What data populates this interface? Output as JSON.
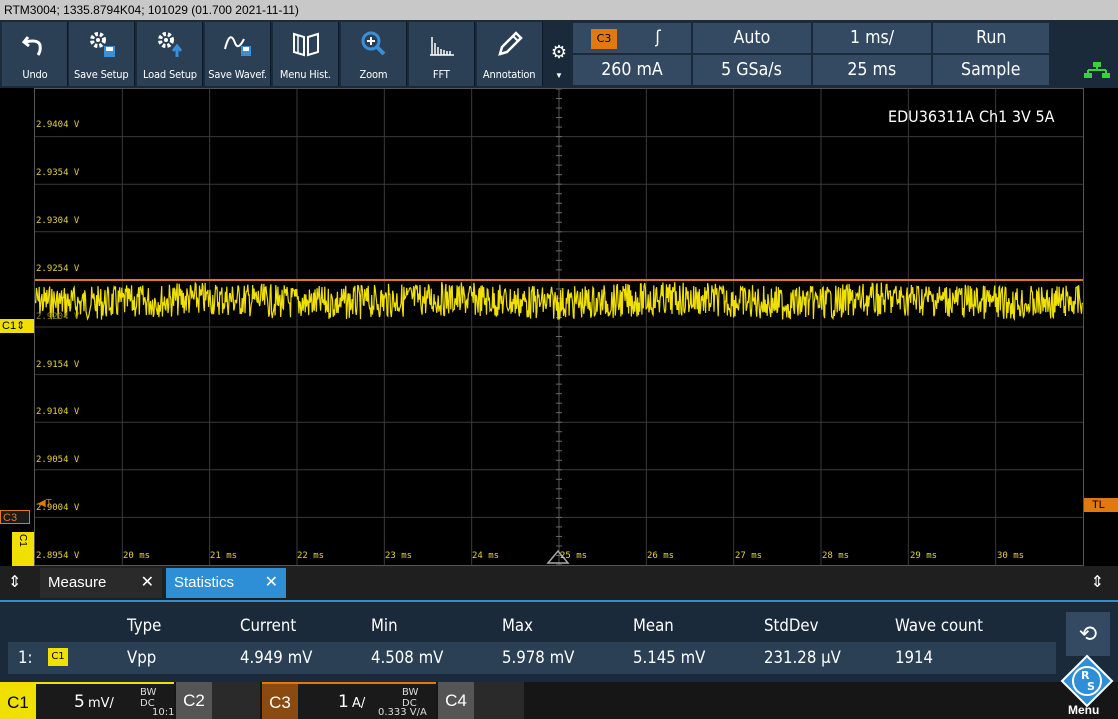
{
  "titlebar": {
    "text": "RTM3004; 1335.8794K04; 101029 (01.700 2021-11-11)"
  },
  "toolbar": {
    "buttons": [
      {
        "label": "Undo"
      },
      {
        "label": "Save Setup"
      },
      {
        "label": "Load Setup"
      },
      {
        "label": "Save Wavef."
      },
      {
        "label": "Menu Hist."
      },
      {
        "label": "Zoom"
      },
      {
        "label": "FFT"
      },
      {
        "label": "Annotation"
      }
    ]
  },
  "params": {
    "trigger_source": "C3",
    "trigger_slope": "ʃ",
    "trigger_mode": "Auto",
    "timebase": "1 ms/",
    "run_state": "Run",
    "trigger_level": "260 mA",
    "sample_rate": "5 GSa/s",
    "record_length": "25 ms",
    "acquire_mode": "Sample"
  },
  "screen": {
    "probe_label": "EDU36311A Ch1 3V 5A",
    "y_labels": [
      "2.9404 V",
      "2.9354 V",
      "2.9304 V",
      "2.9254 V",
      "2.9204 V",
      "2.9154 V",
      "2.9104 V",
      "2.9054 V",
      "2.9004 V",
      "2.8954 V"
    ],
    "x_labels": [
      "20 ms",
      "21 ms",
      "22 ms",
      "23 ms",
      "24 ms",
      "25 ms",
      "26 ms",
      "27 ms",
      "28 ms",
      "29 ms",
      "30 ms"
    ],
    "markers": {
      "c1": "C1",
      "c3": "C3",
      "tl": "TL",
      "t": "T"
    }
  },
  "tabs": {
    "measure": "Measure",
    "statistics": "Statistics",
    "close": "✕"
  },
  "stats": {
    "headers": [
      "Type",
      "Current",
      "Min",
      "Max",
      "Mean",
      "StdDev",
      "Wave count"
    ],
    "row": {
      "index": "1:",
      "source": "C1",
      "type": "Vpp",
      "current": "4.949 mV",
      "min": "4.508 mV",
      "max": "5.978 mV",
      "mean": "5.145 mV",
      "stddev": "231.28 µV",
      "wave_count": "1914"
    }
  },
  "channels": {
    "c1": {
      "name": "C1",
      "scale": "5",
      "unit": "mV/",
      "coupling": "BW DC",
      "probe": "10:1"
    },
    "c2": {
      "name": "C2"
    },
    "c3": {
      "name": "C3",
      "scale": "1",
      "unit": "A/",
      "coupling": "BW DC",
      "probe": "0.333 V/A"
    },
    "c4": {
      "name": "C4"
    },
    "menu": "Menu"
  },
  "colors": {
    "c1": "#f0e000",
    "c3": "#e07a10",
    "accent": "#2e8fd6"
  }
}
